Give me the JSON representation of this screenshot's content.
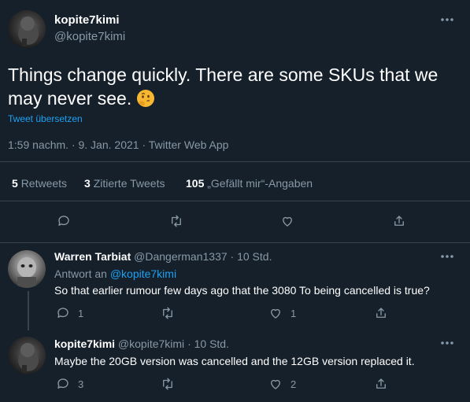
{
  "main_tweet": {
    "display_name": "kopite7kimi",
    "handle": "@kopite7kimi",
    "text": "Things change quickly. There are some SKUs that we may never see.",
    "emoji": "🤔",
    "translate_label": "Tweet übersetzen",
    "timestamp": "1:59 nachm. · 9. Jan. 2021 · Twitter Web App",
    "stats": {
      "retweets_count": "5",
      "retweets_label": "Retweets",
      "quotes_count": "3",
      "quotes_label": "Zitierte Tweets",
      "likes_count": "105",
      "likes_label": "„Gefällt mir“-Angaben"
    }
  },
  "replies": [
    {
      "display_name": "Warren Tarbiat",
      "handle": "@Dangerman1337",
      "time": "· 10 Std.",
      "reply_to_prefix": "Antwort an",
      "reply_to_handle": "@kopite7kimi",
      "text": "So that earlier rumour few days ago that the 3080 To being cancelled is true?",
      "reply_count": "1",
      "retweet_count": "",
      "like_count": "1"
    },
    {
      "display_name": "kopite7kimi",
      "handle": "@kopite7kimi",
      "time": "· 10 Std.",
      "text": "Maybe the 20GB version was cancelled and the 12GB version replaced it.",
      "reply_count": "3",
      "retweet_count": "",
      "like_count": "2"
    }
  ],
  "icons": {
    "more": "more-dots-icon",
    "reply": "reply-icon",
    "retweet": "retweet-icon",
    "like": "heart-icon",
    "share": "share-icon"
  },
  "colors": {
    "background": "#15202b",
    "muted": "#8899a6",
    "accent": "#1da1f2",
    "divider": "#38444d"
  }
}
